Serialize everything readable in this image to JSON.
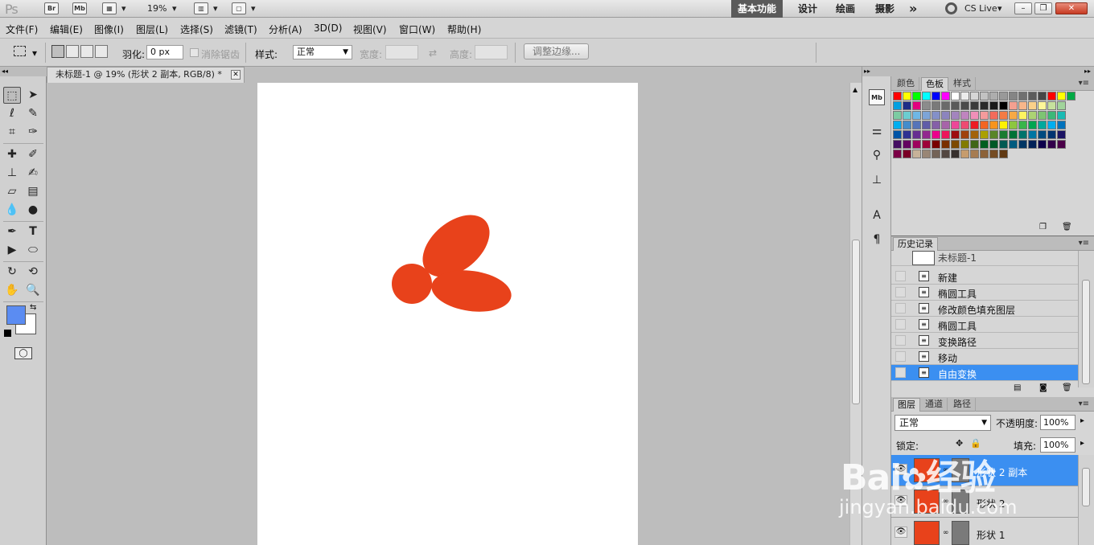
{
  "app": {
    "logo": "Ps",
    "bridge_label": "Br",
    "mini_bridge_label": "Mb",
    "zoom": "19%",
    "workspaces": [
      "基本功能",
      "设计",
      "绘画",
      "摄影"
    ],
    "more_workspaces": "»",
    "cs_live": "CS Live",
    "minimize": "–",
    "restore": "❐",
    "close": "✕"
  },
  "menu": [
    "文件(F)",
    "编辑(E)",
    "图像(I)",
    "图层(L)",
    "选择(S)",
    "滤镜(T)",
    "分析(A)",
    "3D(D)",
    "视图(V)",
    "窗口(W)",
    "帮助(H)"
  ],
  "options": {
    "feather_label": "羽化:",
    "feather_value": "0 px",
    "antialias_label": "消除锯齿",
    "style_label": "样式:",
    "style_value": "正常",
    "width_label": "宽度:",
    "height_label": "高度:",
    "refine_edge": "调整边缘..."
  },
  "document": {
    "tab_title": "未标题-1 @ 19% (形状 2 副本, RGB/8) *",
    "shape_color": "#e8421b"
  },
  "toolbox": {
    "fg_color": "#5b8cf2",
    "bg_color": "#ffffff"
  },
  "swatch_panel": {
    "tabs": [
      "颜色",
      "色板",
      "样式"
    ],
    "active": "色板",
    "rows": [
      [
        "#ff0000",
        "#ffff00",
        "#00ff00",
        "#00ffff",
        "#0000ff",
        "#ff00ff",
        "#ffffff",
        "#ebebeb",
        "#d6d6d6",
        "#c2c2c2",
        "#adadad",
        "#999999",
        "#858585",
        "#707070",
        "#5c5c5c",
        "#474747",
        "#ff0000",
        "#ffff00",
        "#00aa44"
      ],
      [
        "#00a0e0",
        "#1f2d87",
        "#e3007f",
        "#8c8c8c",
        "#7a7a7a",
        "#6a6a6a",
        "#5a5a5a",
        "#4a4a4a",
        "#3a3a3a",
        "#2a2a2a",
        "#1a1a1a",
        "#000000",
        "#f4a090",
        "#f8b68a",
        "#fbd189",
        "#fff799",
        "#c6e19d",
        "#a1d49b"
      ],
      [
        "#7ccba2",
        "#6ccdd0",
        "#6fb7e5",
        "#7da4d7",
        "#8490c8",
        "#8c84be",
        "#a384be",
        "#bf84bf",
        "#f08fb8",
        "#f49b9c",
        "#f26b5b",
        "#f47b44",
        "#f7a945",
        "#fff460",
        "#acd373",
        "#7dc473",
        "#3cb878",
        "#1abbb4"
      ],
      [
        "#00aeef",
        "#438ccb",
        "#5674b9",
        "#605ca8",
        "#855fa8",
        "#a763a9",
        "#ed4698",
        "#ee4b72",
        "#ed1c24",
        "#f26522",
        "#f7941d",
        "#fff200",
        "#8dc63f",
        "#39b54a",
        "#00a651",
        "#00a99d",
        "#00aeef",
        "#0072bc"
      ],
      [
        "#0054a6",
        "#2e3192",
        "#662d91",
        "#92278f",
        "#ec008c",
        "#ed145b",
        "#9e0b0f",
        "#a0410d",
        "#a3620a",
        "#aba000",
        "#598527",
        "#197b30",
        "#007236",
        "#00746b",
        "#0076a3",
        "#004b80",
        "#003471",
        "#1b1464"
      ],
      [
        "#440e62",
        "#630460",
        "#9e005d",
        "#9e0039",
        "#790000",
        "#7a3000",
        "#7d4900",
        "#827b00",
        "#406618",
        "#005e20",
        "#005826",
        "#005952",
        "#005b7f",
        "#003663",
        "#002157",
        "#0d004c",
        "#32004b",
        "#4b0049"
      ],
      [
        "#7b0046",
        "#7a0026",
        "#c7b299",
        "#998675",
        "#736357",
        "#534741",
        "#37302d",
        "#c69c6d",
        "#a67c52",
        "#8c6239",
        "#754c24",
        "#603913"
      ]
    ]
  },
  "history_panel": {
    "title": "历史记录",
    "snapshot": "未标题-1",
    "items": [
      "新建",
      "椭圆工具",
      "修改颜色填充图层",
      "椭圆工具",
      "变换路径",
      "移动",
      "自由变换"
    ],
    "selected_index": 6
  },
  "layers_panel": {
    "tabs": [
      "图层",
      "通道",
      "路径"
    ],
    "blend_mode": "正常",
    "opacity_label": "不透明度:",
    "opacity_value": "100%",
    "lock_label": "锁定:",
    "fill_label": "填充:",
    "fill_value": "100%",
    "layers": [
      {
        "name": "形状 2 副本",
        "selected": true
      },
      {
        "name": "形状 2",
        "selected": false
      },
      {
        "name": "形状 1",
        "selected": false
      }
    ]
  },
  "watermark": {
    "brand": "Bai",
    "brand2": "经验",
    "url": "jingyan.baidu.com"
  }
}
